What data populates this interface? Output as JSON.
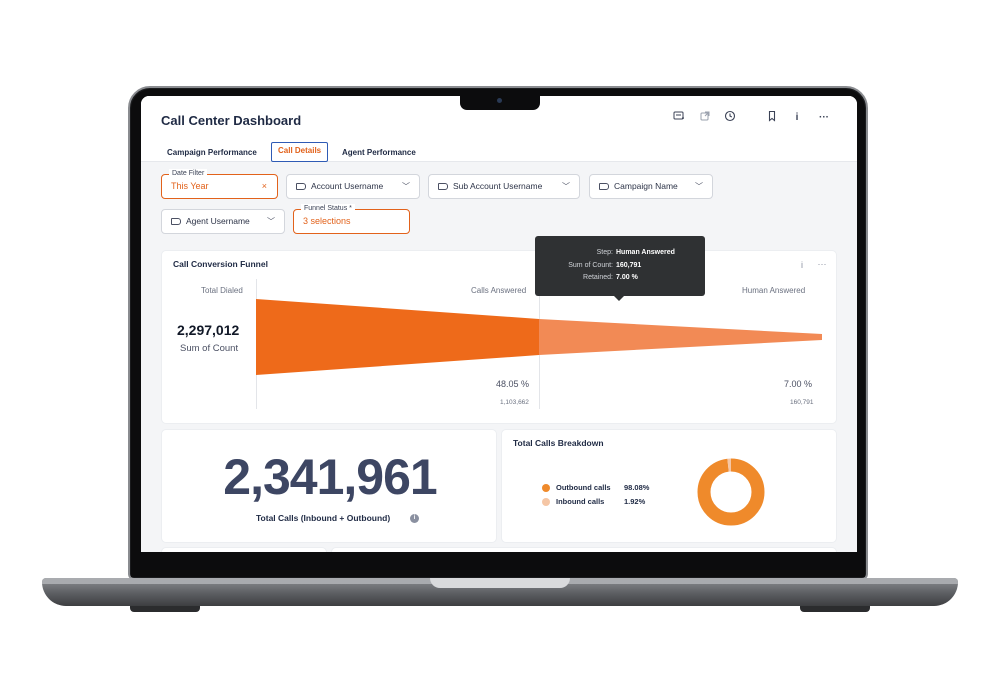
{
  "header": {
    "title": "Call Center Dashboard",
    "icons": [
      "filter-add-icon",
      "external-link-icon",
      "clock-icon",
      "bookmark-icon",
      "info-icon",
      "more-icon"
    ]
  },
  "tabs": [
    {
      "label": "Campaign Performance",
      "active": false
    },
    {
      "label": "Call Details",
      "active": true
    },
    {
      "label": "Agent Performance",
      "active": false
    }
  ],
  "filters": {
    "date": {
      "label": "Date Filter",
      "value": "This Year",
      "clear": "×"
    },
    "account_username": "Account Username",
    "sub_account_username": "Sub Account Username",
    "campaign_name": "Campaign Name",
    "agent_username": "Agent Username",
    "funnel_status": {
      "label": "Funnel Status *",
      "value": "3 selections"
    }
  },
  "funnel_card": {
    "title": "Call Conversion Funnel",
    "total_label": "Total Dialed",
    "total_value": "2,297,012",
    "total_sub": "Sum of Count",
    "steps": [
      {
        "label": "Calls Answered",
        "pct": "48.05 %",
        "count": "1,103,662"
      },
      {
        "label": "Human Answered",
        "pct": "7.00 %",
        "count": "160,791"
      }
    ],
    "colors": {
      "primary": "#ee6a1a",
      "secondary": "#f28a55"
    }
  },
  "tooltip": {
    "rows": [
      {
        "key": "Step:",
        "value": "Human Answered"
      },
      {
        "key": "Sum of Count:",
        "value": "160,791"
      },
      {
        "key": "Retained:",
        "value": "7.00 %"
      }
    ]
  },
  "kpi": {
    "value": "2,341,961",
    "label": "Total Calls (Inbound + Outbound)"
  },
  "breakdown": {
    "title": "Total Calls Breakdown",
    "items": [
      {
        "name": "Outbound calls",
        "value": "98.08%",
        "share": 0.9808,
        "color": "#ef8a2b"
      },
      {
        "name": "Inbound calls",
        "value": "1.92%",
        "share": 0.0192,
        "color": "#f5c6a5"
      }
    ]
  },
  "chart_data": {
    "type": "pie",
    "title": "Total Calls Breakdown",
    "categories": [
      "Outbound calls",
      "Inbound calls"
    ],
    "values": [
      98.08,
      1.92
    ]
  }
}
